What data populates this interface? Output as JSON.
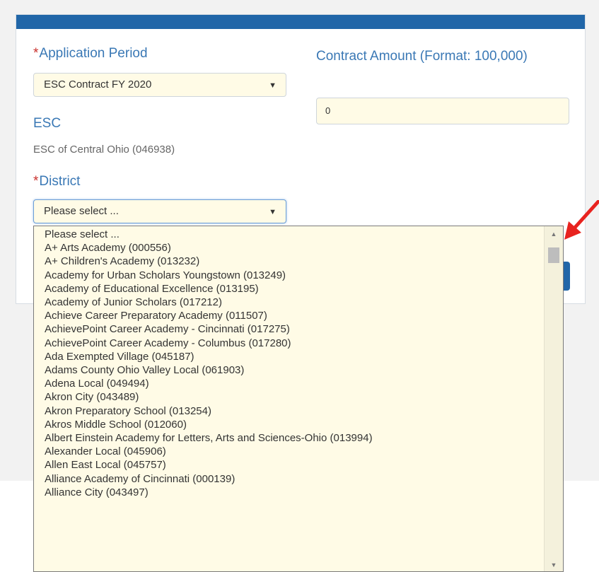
{
  "form": {
    "application_period": {
      "required_mark": "*",
      "label": "Application Period",
      "selected": "ESC Contract FY 2020"
    },
    "contract_amount": {
      "label": "Contract Amount (Format: 100,000)",
      "value": "0"
    },
    "esc": {
      "label": "ESC",
      "value": "ESC of Central Ohio (046938)"
    },
    "district": {
      "required_mark": "*",
      "label": "District",
      "selected": "Please select ..."
    }
  },
  "dropdown": {
    "selected_index": 20,
    "options": [
      "Please select ...",
      "A+ Arts Academy (000556)",
      "A+ Children's Academy (013232)",
      "Academy for Urban Scholars Youngstown (013249)",
      "Academy of Educational Excellence (013195)",
      "Academy of Junior Scholars (017212)",
      "Achieve Career Preparatory Academy (011507)",
      "AchievePoint Career Academy - Cincinnati (017275)",
      "AchievePoint Career Academy - Columbus (017280)",
      "Ada Exempted Village (045187)",
      "Adams County Ohio Valley Local (061903)",
      "Adena Local (049494)",
      "Akron City (043489)",
      "Akron Preparatory School (013254)",
      "Akros Middle School (012060)",
      "Albert Einstein Academy for Letters, Arts and Sciences-Ohio (013994)",
      "Alexander Local (045906)",
      "Allen East Local (045757)",
      "Alliance Academy of Cincinnati (000139)",
      "Alliance City (043497)"
    ]
  },
  "colors": {
    "header_bar": "#2166a8",
    "label_blue": "#3a78b5",
    "required_red": "#c9302c",
    "selected_option": "#2f86dc",
    "annotation_arrow": "#e8231f"
  }
}
